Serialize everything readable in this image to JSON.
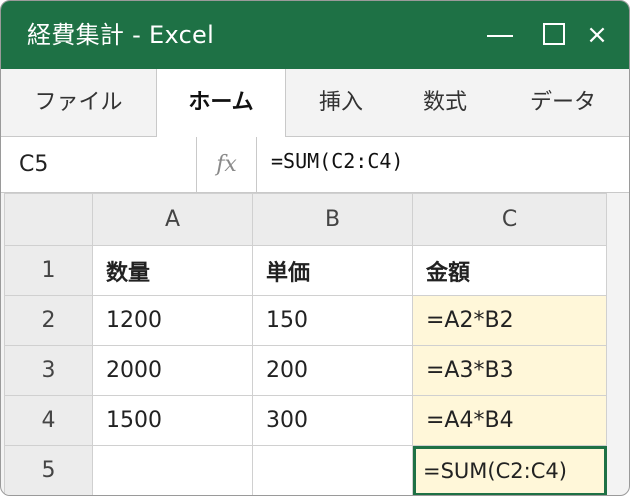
{
  "window": {
    "title": "経費集計 - Excel",
    "minimize": "—",
    "close": "×"
  },
  "tabs": [
    {
      "label": "ファイル",
      "active": false
    },
    {
      "label": "ホーム",
      "active": true
    },
    {
      "label": "挿入",
      "active": false
    },
    {
      "label": "数式",
      "active": false
    },
    {
      "label": "データ",
      "active": false
    }
  ],
  "formula_bar": {
    "cell_ref": "C5",
    "fx_label": "fx",
    "formula": "=SUM(C2:C4)"
  },
  "sheet": {
    "columns": [
      "A",
      "B",
      "C"
    ],
    "rows": [
      {
        "num": "1",
        "cells": [
          "数量",
          "単価",
          "金額"
        ]
      },
      {
        "num": "2",
        "cells": [
          "1200",
          "150",
          "=A2*B2"
        ]
      },
      {
        "num": "3",
        "cells": [
          "2000",
          "200",
          "=A3*B3"
        ]
      },
      {
        "num": "4",
        "cells": [
          "1500",
          "300",
          "=A4*B4"
        ]
      },
      {
        "num": "5",
        "cells": [
          "",
          "",
          "=SUM(C2:C4)"
        ]
      }
    ],
    "selected_cell": "C5"
  },
  "colors": {
    "brand": "#1e7145",
    "formula_cell_fill": "#fff7d9"
  }
}
